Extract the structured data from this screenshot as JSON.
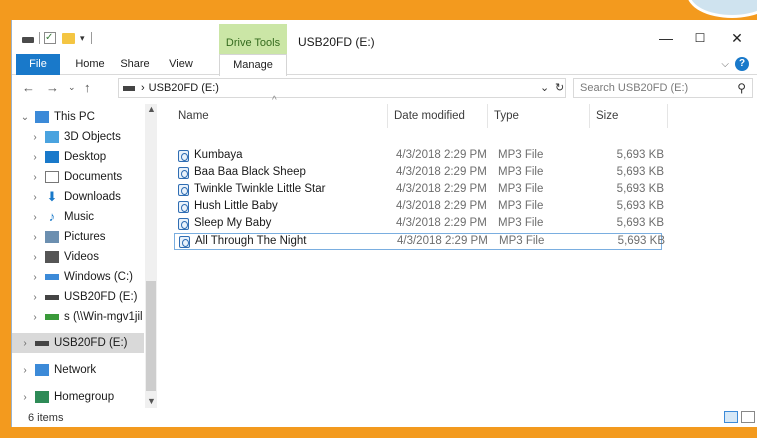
{
  "window": {
    "title": "USB20FD (E:)",
    "contextual_tab_group": "Drive Tools",
    "controls": {
      "minimize": "—",
      "maximize": "☐",
      "close": "✕"
    }
  },
  "ribbon": {
    "tabs": [
      "File",
      "Home",
      "Share",
      "View",
      "Manage"
    ],
    "help": "?"
  },
  "address_bar": {
    "path_drive": "USB20FD (E:)",
    "separator": "›",
    "search_placeholder": "Search USB20FD (E:)"
  },
  "columns": {
    "name": "Name",
    "date_modified": "Date modified",
    "type": "Type",
    "size": "Size"
  },
  "files": [
    {
      "name": "Kumbaya",
      "date": "4/3/2018 2:29 PM",
      "type": "MP3 File",
      "size": "5,693 KB"
    },
    {
      "name": "Baa Baa Black Sheep",
      "date": "4/3/2018 2:29 PM",
      "type": "MP3 File",
      "size": "5,693 KB"
    },
    {
      "name": "Twinkle Twinkle Little Star",
      "date": "4/3/2018 2:29 PM",
      "type": "MP3 File",
      "size": "5,693 KB"
    },
    {
      "name": "Hush Little Baby",
      "date": "4/3/2018 2:29 PM",
      "type": "MP3 File",
      "size": "5,693 KB"
    },
    {
      "name": "Sleep My Baby",
      "date": "4/3/2018 2:29 PM",
      "type": "MP3 File",
      "size": "5,693 KB"
    },
    {
      "name": "All Through The Night",
      "date": "4/3/2018 2:29 PM",
      "type": "MP3 File",
      "size": "5,693 KB"
    }
  ],
  "nav": {
    "this_pc": "This PC",
    "items": [
      "3D Objects",
      "Desktop",
      "Documents",
      "Downloads",
      "Music",
      "Pictures",
      "Videos",
      "Windows (C:)",
      "USB20FD (E:)",
      "s (\\\\Win-mgv1jil"
    ],
    "usb_root": "USB20FD (E:)",
    "network": "Network",
    "homegroup": "Homegroup"
  },
  "status": {
    "item_count": "6 items"
  },
  "colors": {
    "accent": "#1979ca",
    "frame": "#f39a1e",
    "drive_tools": "#cbe6a6",
    "selected_nav": "#d9d9d9"
  }
}
